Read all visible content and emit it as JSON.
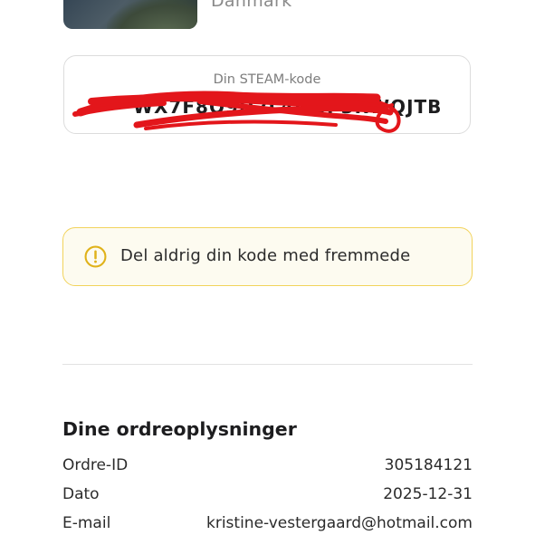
{
  "product": {
    "region": "Danmark",
    "icon": "game-cover-image"
  },
  "code_card": {
    "label": "Din STEAM-kode",
    "value": "WX7F8Q9H2L4M6P3RWQJTB",
    "redaction_color": "#e3161b"
  },
  "warning": {
    "text": "Del aldrig din kode med fremmede",
    "icon": "exclamation-circle-icon",
    "border_color": "#f2d35c",
    "background_color": "#fdfbf0"
  },
  "order_info": {
    "title": "Dine ordreoplysninger",
    "rows": [
      {
        "label": "Ordre-ID",
        "value": "305184121"
      },
      {
        "label": "Dato",
        "value": "2025-12-31"
      },
      {
        "label": "E-mail",
        "value": "kristine-vestergaard@hotmail.com"
      }
    ]
  }
}
